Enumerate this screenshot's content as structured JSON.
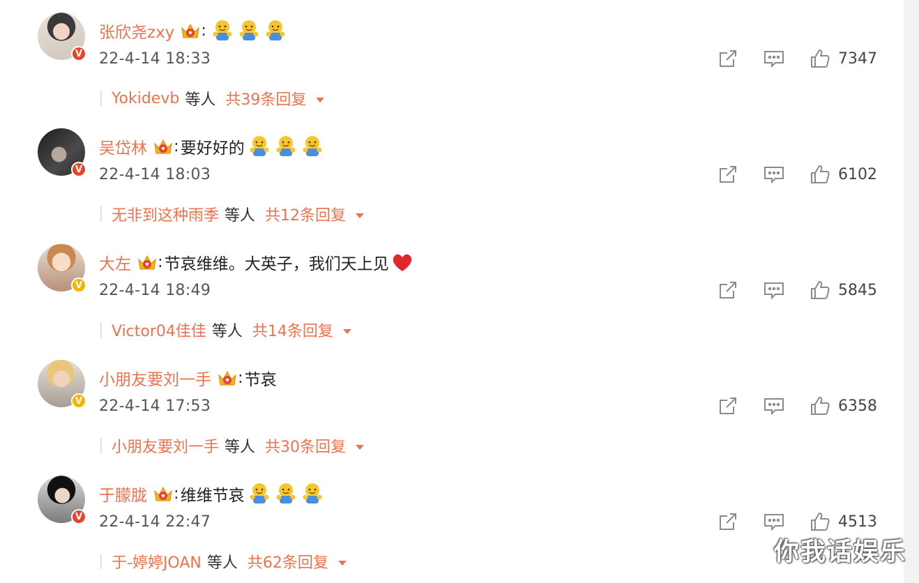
{
  "comments": [
    {
      "username": "张欣尧zxy",
      "text": "",
      "emoji_count": 3,
      "heart": false,
      "time": "22-4-14 18:33",
      "likes": "7347",
      "badge": "red",
      "reply_user": "Yokidevb",
      "reply_etc": "等人",
      "reply_total": "共39条回复"
    },
    {
      "username": "吴岱林",
      "text": "要好好的",
      "emoji_count": 3,
      "heart": false,
      "time": "22-4-14 18:03",
      "likes": "6102",
      "badge": "red",
      "reply_user": "无非到这种雨季",
      "reply_etc": "等人",
      "reply_total": "共12条回复"
    },
    {
      "username": "大左",
      "text": "节哀维维。大英子，我们天上见",
      "emoji_count": 0,
      "heart": true,
      "time": "22-4-14 18:49",
      "likes": "5845",
      "badge": "gold",
      "reply_user": "Victor04佳佳",
      "reply_etc": "等人",
      "reply_total": "共14条回复"
    },
    {
      "username": "小朋友要刘一手",
      "text": "节哀",
      "emoji_count": 0,
      "heart": false,
      "time": "22-4-14 17:53",
      "likes": "6358",
      "badge": "gold",
      "reply_user": "小朋友要刘一手",
      "reply_etc": "等人",
      "reply_total": "共30条回复"
    },
    {
      "username": "于朦胧",
      "text": "维维节哀",
      "emoji_count": 3,
      "heart": false,
      "time": "22-4-14 22:47",
      "likes": "4513",
      "badge": "red",
      "reply_user": "于-婷婷JOAN",
      "reply_etc": "等人",
      "reply_total": "共62条回复"
    }
  ],
  "icons": {
    "share": "share-icon",
    "comment": "comment-icon",
    "like": "thumbs-up-icon",
    "crown": "fan-crown-icon",
    "emoji": "hug-emoji-icon",
    "heart": "red-heart-icon"
  },
  "colors": {
    "username": "#eb7350",
    "badge_red": "#e8452c",
    "badge_gold": "#f4b400",
    "icon": "#888888"
  },
  "watermark": "你我话娱乐"
}
